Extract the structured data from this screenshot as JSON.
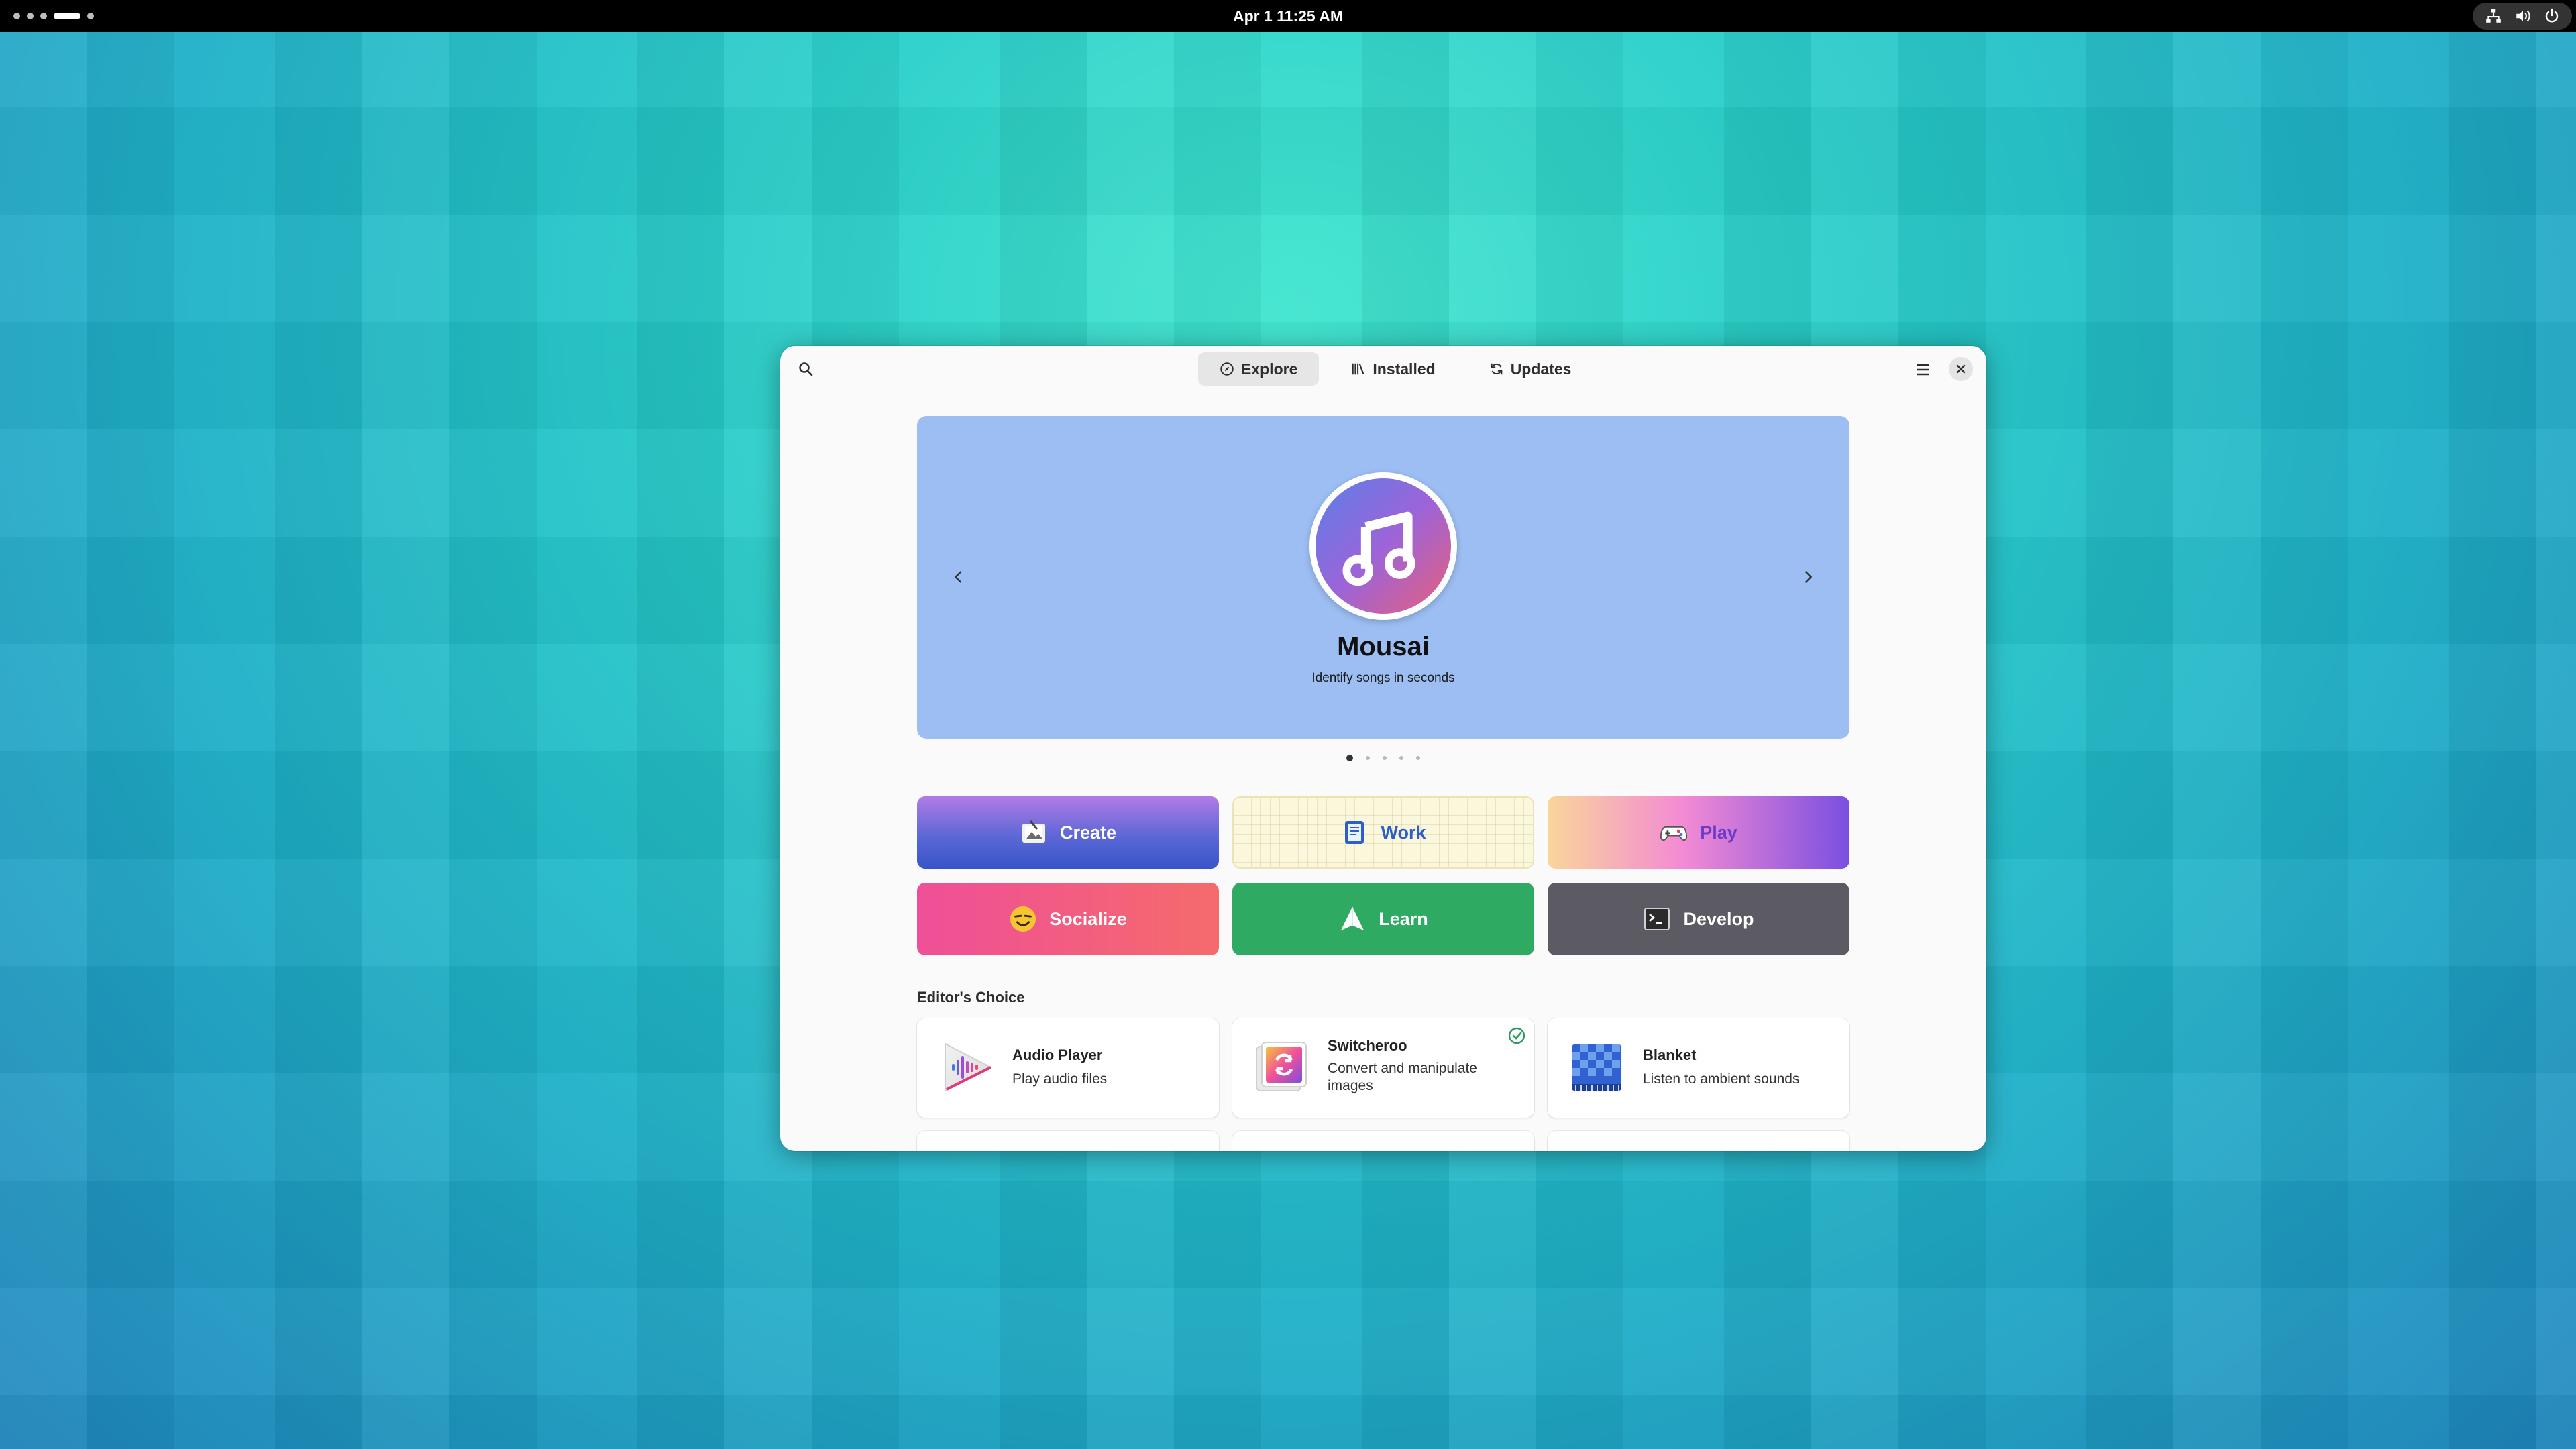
{
  "topbar": {
    "clock": "Apr 1  11:25 AM"
  },
  "header": {
    "tabs": [
      {
        "label": "Explore",
        "icon": "compass-icon",
        "active": true
      },
      {
        "label": "Installed",
        "icon": "library-icon",
        "active": false
      },
      {
        "label": "Updates",
        "icon": "refresh-icon",
        "active": false
      }
    ]
  },
  "banner": {
    "title": "Mousai",
    "subtitle": "Identify songs in seconds",
    "icon": "music-note-icon",
    "pages": 5,
    "current_page": 1
  },
  "categories": [
    {
      "label": "Create",
      "icon": "create-icon"
    },
    {
      "label": "Work",
      "icon": "notebook-icon"
    },
    {
      "label": "Play",
      "icon": "gamepad-icon"
    },
    {
      "label": "Socialize",
      "icon": "smiley-icon"
    },
    {
      "label": "Learn",
      "icon": "paper-plane-icon"
    },
    {
      "label": "Develop",
      "icon": "terminal-icon"
    }
  ],
  "editors_choice": {
    "title": "Editor's Choice",
    "apps": [
      {
        "name": "Audio Player",
        "description": "Play audio files",
        "icon": "audio-player-icon",
        "installed": false
      },
      {
        "name": "Switcheroo",
        "description": "Convert and manipulate images",
        "icon": "switcheroo-icon",
        "installed": true
      },
      {
        "name": "Blanket",
        "description": "Listen to ambient sounds",
        "icon": "blanket-icon",
        "installed": false
      }
    ]
  },
  "colors": {
    "banner_bg": "#9cbef2",
    "installed_check": "#2e9a62"
  }
}
